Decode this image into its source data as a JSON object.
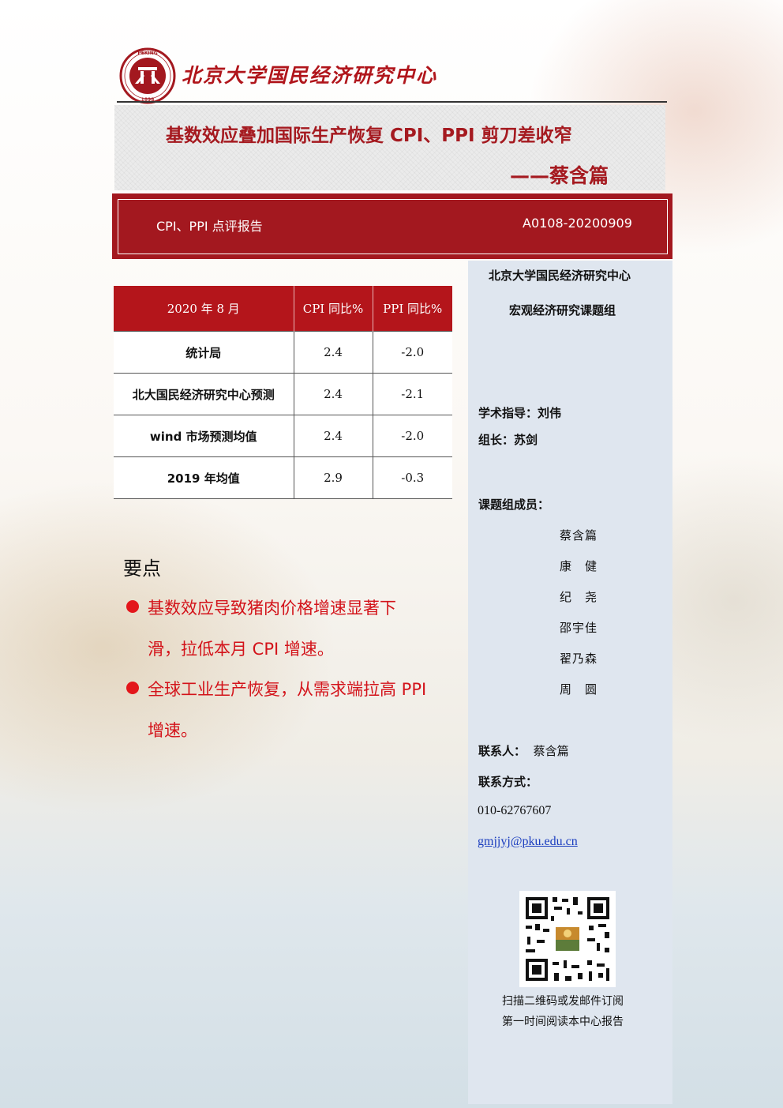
{
  "header": {
    "logo_text": "PEKING UNIVERSITY 1898",
    "org_name": "北京大学国民经济研究中心"
  },
  "title": {
    "main": "基数效应叠加国际生产恢复 CPI、PPI 剪刀差收窄",
    "author": "——蔡含篇"
  },
  "band": {
    "left": "CPI、PPI 点评报告",
    "right": "A0108-20200909"
  },
  "table": {
    "headers": [
      "2020 年 8 月",
      "CPI 同比%",
      "PPI 同比%"
    ],
    "rows": [
      {
        "label": "统计局",
        "cpi": "2.4",
        "ppi": "-2.0"
      },
      {
        "label": "北大国民经济研究中心预测",
        "cpi": "2.4",
        "ppi": "-2.1"
      },
      {
        "label": "wind 市场预测均值",
        "cpi": "2.4",
        "ppi": "-2.0"
      },
      {
        "label": "2019 年均值",
        "cpi": "2.9",
        "ppi": "-0.3"
      }
    ]
  },
  "key_points": {
    "title": "要点",
    "lines": [
      "基数效应导致猪肉价格增速显著下",
      "滑，拉低本月 CPI 增速。",
      "全球工业生产恢复，从需求端拉高 PPI",
      "增速。"
    ]
  },
  "sidebar": {
    "org": "北京大学国民经济研究中心",
    "group": "宏观经济研究课题组",
    "advisor": "学术指导：刘伟",
    "leader": "组长：苏剑",
    "members_label": "课题组成员：",
    "members": [
      "蔡含篇",
      "康　健",
      "纪　尧",
      "邵宇佳",
      "翟乃森",
      "周　圆"
    ],
    "contact_label": "联系人：",
    "contact_name": "蔡含篇",
    "contact_method_label": "联系方式：",
    "phone": "010-62767607",
    "email": "gmjjyj@pku.edu.cn",
    "qr_caption_1": "扫描二维码或发邮件订阅",
    "qr_caption_2": "第一时间阅读本中心报告"
  },
  "colors": {
    "brand_red": "#a3181f",
    "point_red": "#d3131a",
    "sidebar_bg": "#dfe6ef"
  }
}
